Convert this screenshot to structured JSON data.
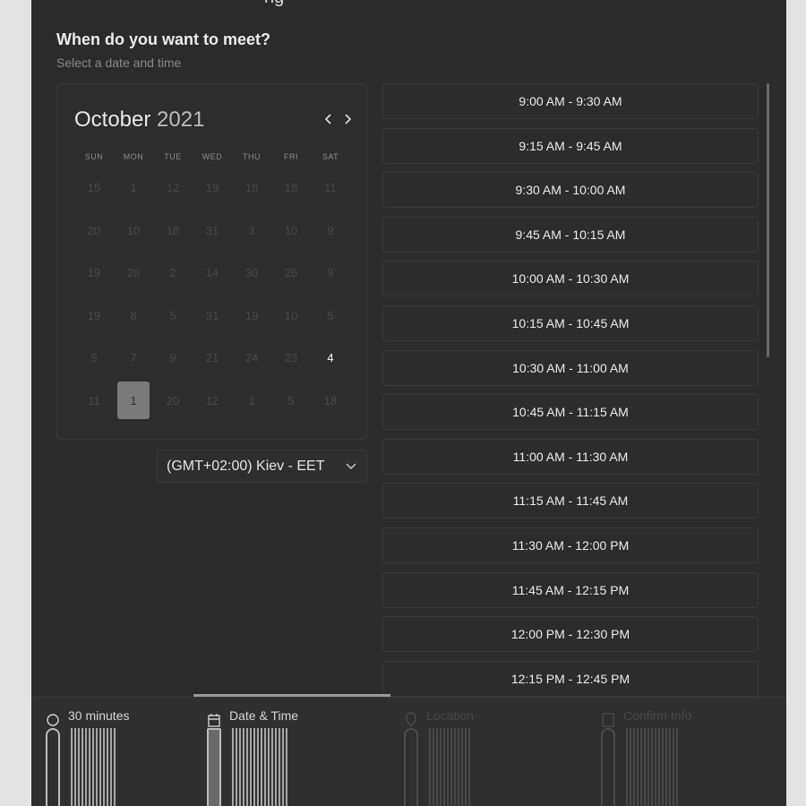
{
  "header": {
    "title": "ng"
  },
  "question": {
    "title": "When do you want to meet?",
    "subtitle": "Select a date and time"
  },
  "calendar": {
    "month": "October",
    "year": "2021",
    "prev_icon": "chevron-left-icon",
    "next_icon": "chevron-right-icon",
    "weekdays": [
      "SUN",
      "MON",
      "TUE",
      "WED",
      "THU",
      "FRI",
      "SAT"
    ],
    "weeks": [
      [
        "15",
        "1",
        "12",
        "19",
        "18",
        "18",
        "11"
      ],
      [
        "20",
        "10",
        "18",
        "31",
        "3",
        "10",
        "9"
      ],
      [
        "19",
        "28",
        "2",
        "14",
        "30",
        "26",
        "9"
      ],
      [
        "19",
        "8",
        "5",
        "31",
        "19",
        "10",
        "5"
      ],
      [
        "5",
        "7",
        "9",
        "21",
        "24",
        "23",
        "4"
      ],
      [
        "11",
        "1",
        "20",
        "12",
        "1",
        "5",
        "18"
      ]
    ],
    "active_days": [
      "4"
    ],
    "selected_day": "1"
  },
  "timezone": {
    "value": "(GMT+02:00) Kiev - EET",
    "icon": "chevron-down-icon"
  },
  "slots": [
    "9:00 AM - 9:30 AM",
    "9:15 AM - 9:45 AM",
    "9:30 AM - 10:00 AM",
    "9:45 AM - 10:15 AM",
    "10:00 AM - 10:30 AM",
    "10:15 AM - 10:45 AM",
    "10:30 AM - 11:00 AM",
    "10:45 AM - 11:15 AM",
    "11:00 AM - 11:30 AM",
    "11:15 AM - 11:45 AM",
    "11:30 AM - 12:00 PM",
    "11:45 AM - 12:15 PM",
    "12:00 PM - 12:30 PM",
    "12:15 PM - 12:45 PM"
  ],
  "steps": [
    {
      "label": "30 minutes",
      "icon": "clock-icon"
    },
    {
      "label": "Date & Time",
      "icon": "calendar-icon"
    },
    {
      "label": "Location",
      "icon": "location-pin-icon"
    },
    {
      "label": "Confirm Info",
      "icon": "document-icon"
    }
  ],
  "colors": {
    "background": "#2b2b2b",
    "selected_day": "#7a7a7a",
    "outer": "#e3e3e3"
  }
}
